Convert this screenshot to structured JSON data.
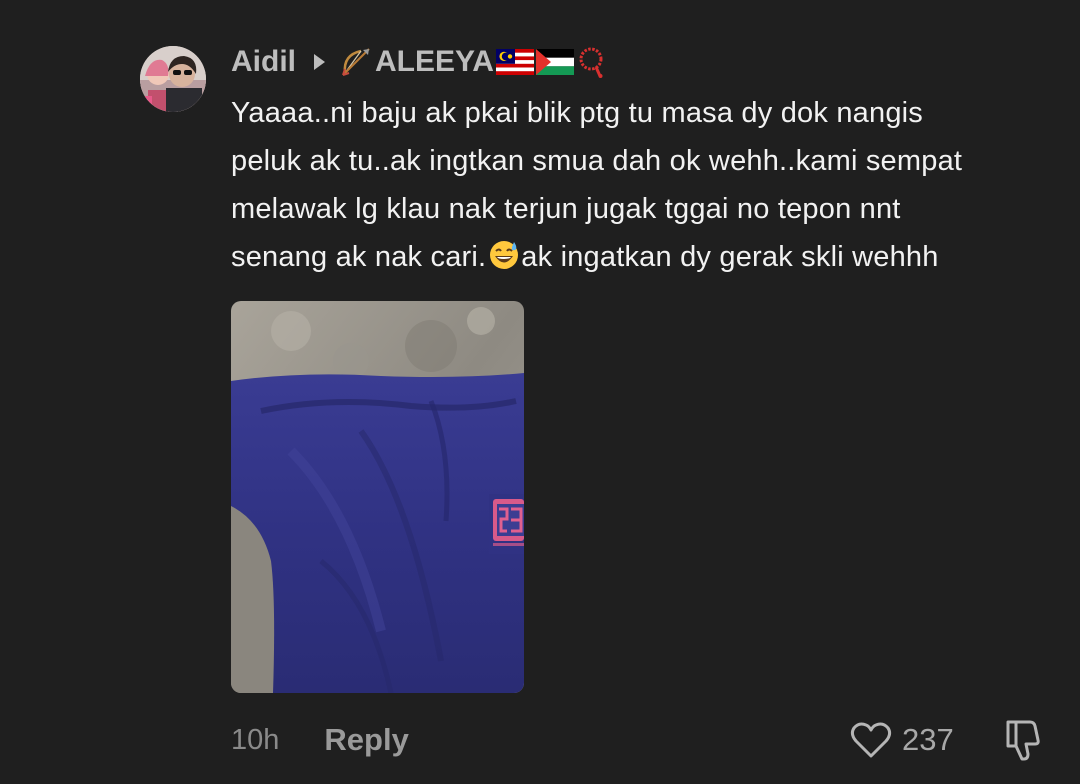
{
  "comment": {
    "author": "Aidil",
    "avatar_icon": "user-avatar",
    "reply_to": "ALEEYA",
    "reply_to_emojis": [
      "bow-and-arrow",
      "flag-malaysia",
      "flag-palestine",
      "prayer-beads"
    ],
    "text_lines": [
      "Yaaaa..ni baju ak pkai blik ptg tu masa dy dok nangis",
      "peluk ak tu..ak ingtkan smua dah ok wehh..kami sempat",
      "melawak lg klau nak terjun jugak tggai no tepon nnt"
    ],
    "text_line4_before": "senang ak nak cari.",
    "inline_emoji": "grinning-face-with-sweat",
    "text_line4_after": "ak ingatkan dy gerak skli wehhh",
    "photo_alt": "blue shirt on concrete floor",
    "time_ago": "10h",
    "reply_label": "Reply",
    "like_count": "237"
  },
  "colors": {
    "background": "#1f1f1f",
    "text": "#f2f2f2",
    "muted": "#8a8a8a"
  }
}
